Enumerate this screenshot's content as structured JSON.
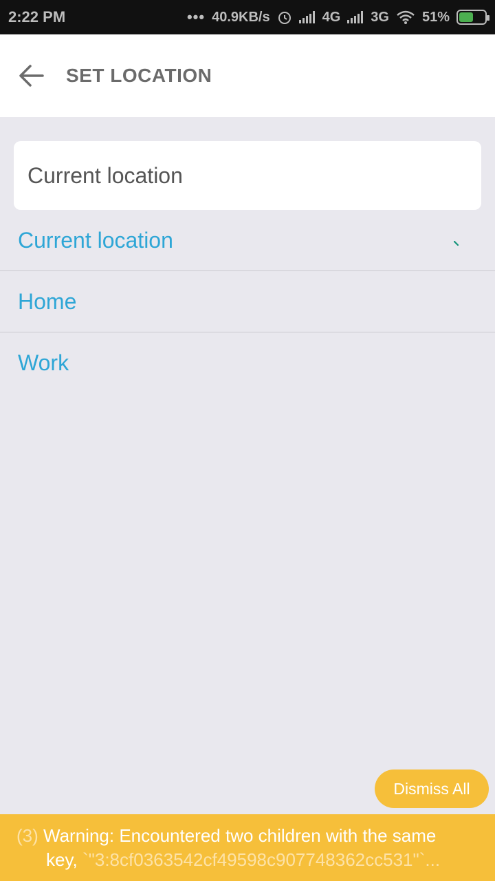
{
  "status_bar": {
    "time": "2:22 PM",
    "dots": "•••",
    "net_speed": "40.9KB/s",
    "net1": "4G",
    "net2": "3G",
    "battery": "51%"
  },
  "app_bar": {
    "back_icon": "arrow-left-icon",
    "title": "SET LOCATION"
  },
  "search": {
    "placeholder": "Current location"
  },
  "locations": [
    {
      "label": "Current location"
    },
    {
      "label": "Home"
    },
    {
      "label": "Work"
    }
  ],
  "dismiss_label": "Dismiss All",
  "warning": {
    "count": "(3)",
    "message": "Warning: Encountered two children with the same",
    "key_prefix": "key, ",
    "key_value": "`\"3:8cf0363542cf49598c907748362cc531\"`..."
  },
  "colors": {
    "accent": "#2ea6d6",
    "warning_bg": "#f6bf3a",
    "page_bg": "#e9e8ee"
  }
}
